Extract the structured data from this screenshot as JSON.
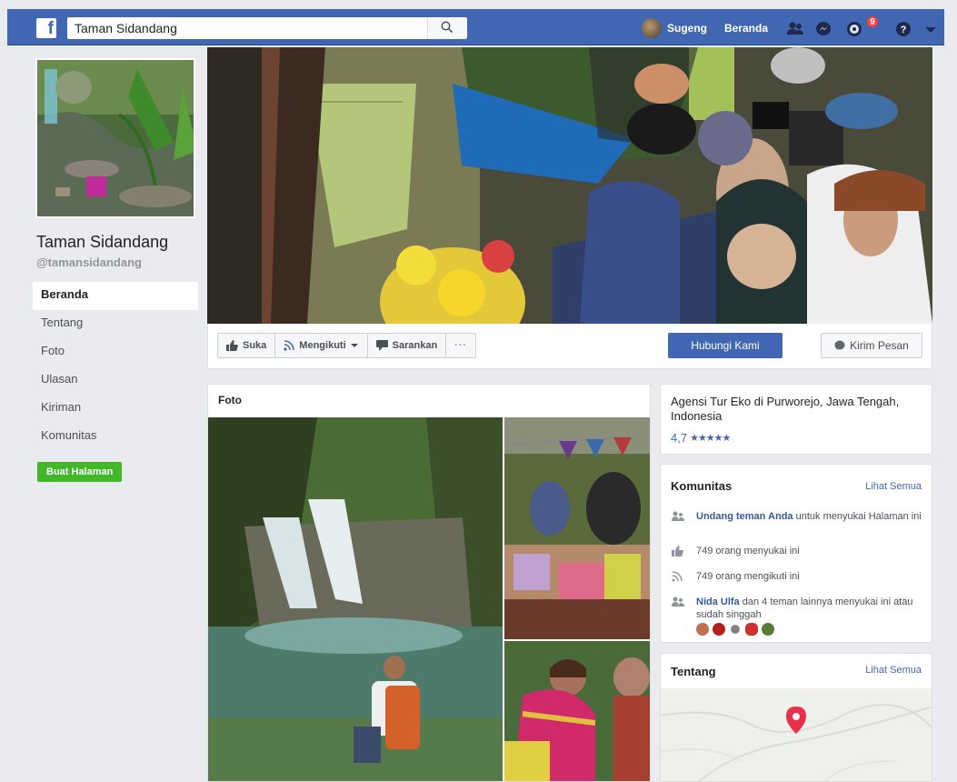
{
  "topbar": {
    "logo": "f",
    "search_value": "Taman Sidandang",
    "user_name": "Sugeng",
    "home_label": "Beranda",
    "notification_count": "9",
    "icons": [
      "friends-icon",
      "messenger-icon",
      "notifications-icon",
      "help-icon",
      "dropdown-icon"
    ]
  },
  "page": {
    "name": "Taman Sidandang",
    "handle": "@tamansidandang"
  },
  "left_nav": {
    "items": [
      {
        "label": "Beranda",
        "active": true
      },
      {
        "label": "Tentang"
      },
      {
        "label": "Foto"
      },
      {
        "label": "Ulasan"
      },
      {
        "label": "Kiriman"
      },
      {
        "label": "Komunitas"
      }
    ],
    "create_page_label": "Buat Halaman"
  },
  "actions": {
    "like_label": "Suka",
    "follow_label": "Mengikuti",
    "share_label": "Sarankan",
    "more_label": "···",
    "contact_label": "Hubungi Kami",
    "message_label": "Kirim Pesan"
  },
  "photos": {
    "title": "Foto"
  },
  "info": {
    "description": "Agensi Tur Eko di Purworejo, Jawa Tengah, Indonesia",
    "rating": "4,7",
    "stars": "★★★★★"
  },
  "community": {
    "title": "Komunitas",
    "see_all": "Lihat Semua",
    "invite_link": "Undang teman Anda",
    "invite_rest": " untuk menyukai Halaman ini",
    "likes_text": "749 orang menyukai ini",
    "follows_text": "749 orang mengikuti ini",
    "friend_link": "Nida Ulfa",
    "friend_rest": " dan 4 teman lainnya menyukai ini atau sudah singgah"
  },
  "about": {
    "title": "Tentang",
    "see_all": "Lihat Semua"
  },
  "colors": {
    "brand_blue": "#4267b2",
    "background": "#e9ebee",
    "green_button": "#42b72a",
    "link": "#365899",
    "map_pin": "#e8304a"
  }
}
